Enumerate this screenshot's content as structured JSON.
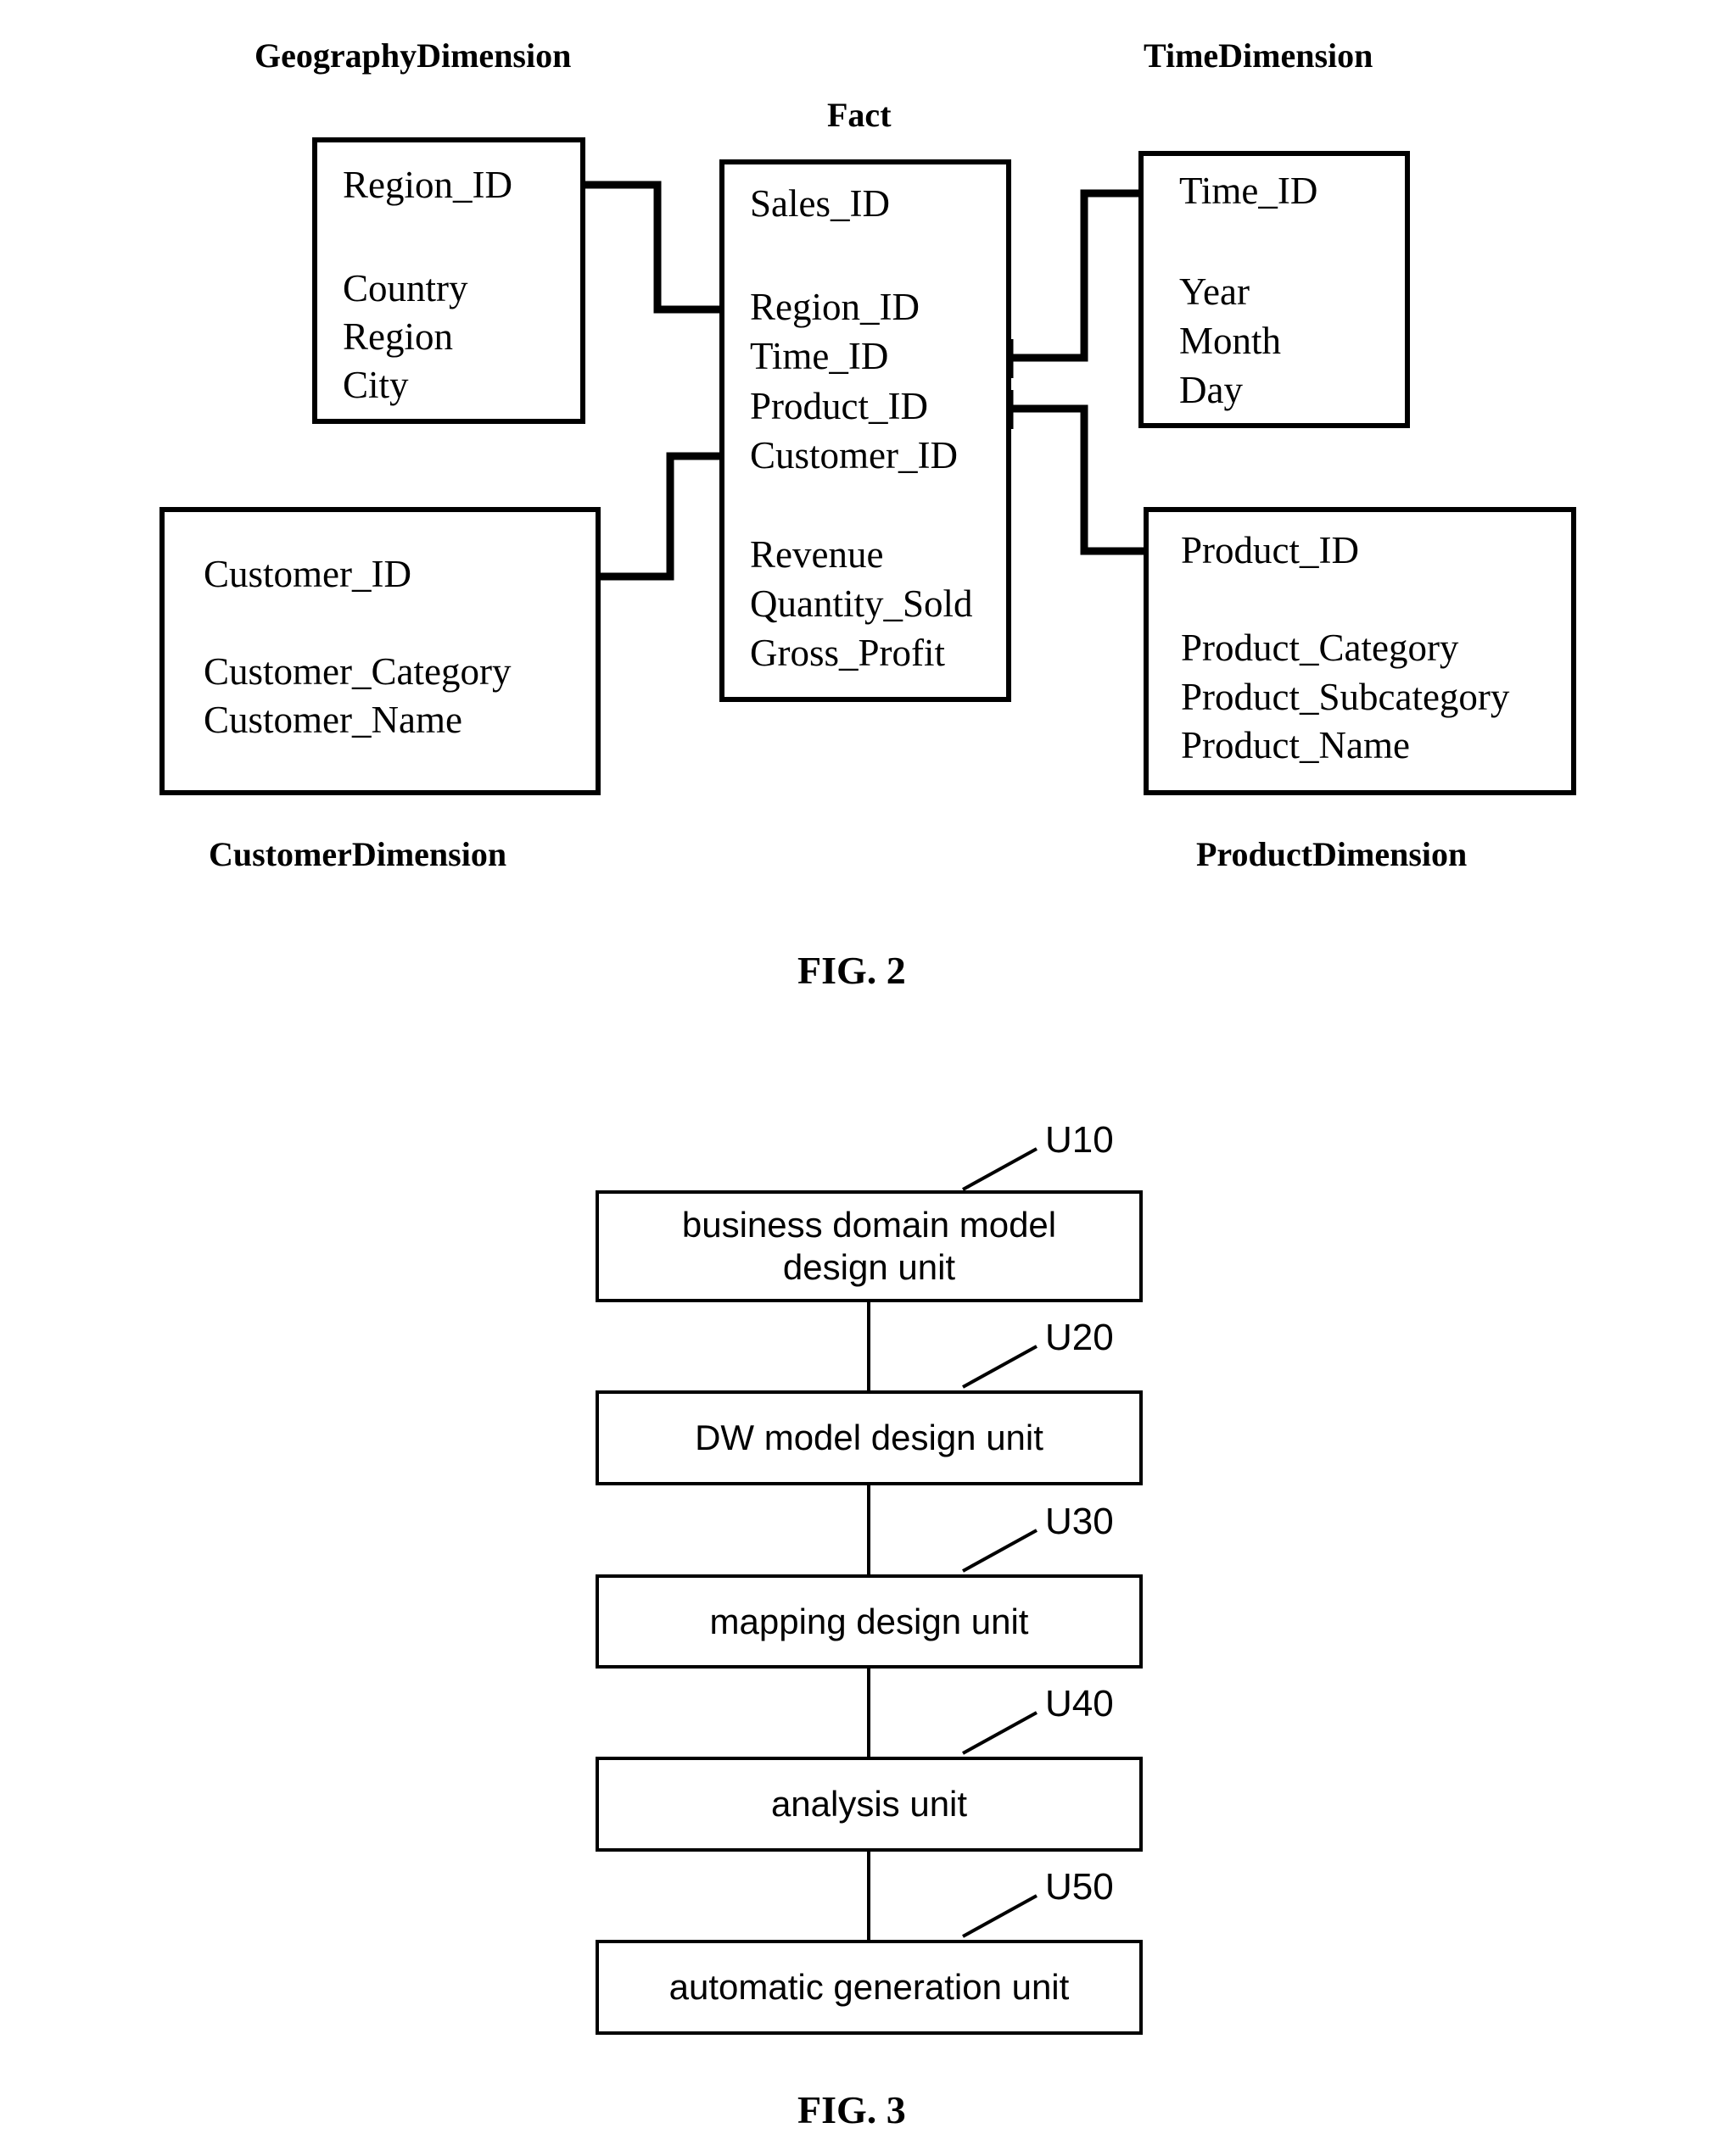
{
  "figures": [
    {
      "id": "fig2",
      "caption": "FIG. 2",
      "type": "star-schema-er-diagram",
      "entities": [
        {
          "name": "GeographyDimension",
          "title_position": "above",
          "key_attributes": [
            "Region_ID"
          ],
          "attributes": [
            "Country",
            "Region",
            "City"
          ]
        },
        {
          "name": "Fact",
          "title_position": "above",
          "key_attributes": [
            "Sales_ID"
          ],
          "foreign_keys": [
            "Region_ID",
            "Time_ID",
            "Product_ID",
            "Customer_ID"
          ],
          "measures": [
            "Revenue",
            "Quantity_Sold",
            "Gross_Profit"
          ]
        },
        {
          "name": "TimeDimension",
          "title_position": "above",
          "key_attributes": [
            "Time_ID"
          ],
          "attributes": [
            "Year",
            "Month",
            "Day"
          ]
        },
        {
          "name": "CustomerDimension",
          "title_position": "below",
          "key_attributes": [
            "Customer_ID"
          ],
          "attributes": [
            "Customer_Category",
            "Customer_Name"
          ]
        },
        {
          "name": "ProductDimension",
          "title_position": "below",
          "key_attributes": [
            "Product_ID"
          ],
          "attributes": [
            "Product_Category",
            "Product_Subcategory",
            "Product_Name"
          ]
        }
      ],
      "relationships": [
        {
          "from": "GeographyDimension.Region_ID",
          "to": "Fact.Region_ID"
        },
        {
          "from": "Fact.Time_ID",
          "to": "TimeDimension.Time_ID"
        },
        {
          "from": "Fact.Product_ID",
          "to": "ProductDimension.Product_ID"
        },
        {
          "from": "CustomerDimension.Customer_ID",
          "to": "Fact.Customer_ID"
        }
      ]
    },
    {
      "id": "fig3",
      "caption": "FIG. 3",
      "type": "vertical-flowchart",
      "steps": [
        {
          "ref": "U10",
          "label": "business domain model design unit",
          "label_lines": [
            "business domain model",
            "design unit"
          ]
        },
        {
          "ref": "U20",
          "label": "DW model design unit",
          "label_lines": [
            "DW model design unit"
          ]
        },
        {
          "ref": "U30",
          "label": "mapping design unit",
          "label_lines": [
            "mapping design unit"
          ]
        },
        {
          "ref": "U40",
          "label": "analysis unit",
          "label_lines": [
            "analysis unit"
          ]
        },
        {
          "ref": "U50",
          "label": "automatic generation unit",
          "label_lines": [
            "automatic generation unit"
          ]
        }
      ]
    }
  ],
  "fig2": {
    "captions": {
      "fig": "FIG. 2"
    },
    "geography": {
      "title": "GeographyDimension",
      "a0": "Region_ID",
      "a1": "Country",
      "a2": "Region",
      "a3": "City"
    },
    "fact": {
      "title": "Fact",
      "a0": "Sales_ID",
      "a1": "Region_ID",
      "a2": "Time_ID",
      "a3": "Product_ID",
      "a4": "Customer_ID",
      "a5": "Revenue",
      "a6": "Quantity_Sold",
      "a7": "Gross_Profit"
    },
    "time": {
      "title": "TimeDimension",
      "a0": "Time_ID",
      "a1": "Year",
      "a2": "Month",
      "a3": "Day"
    },
    "customer": {
      "title": "CustomerDimension",
      "a0": "Customer_ID",
      "a1": "Customer_Category",
      "a2": "Customer_Name"
    },
    "product": {
      "title": "ProductDimension",
      "a0": "Product_ID",
      "a1": "Product_Category",
      "a2": "Product_Subcategory",
      "a3": "Product_Name"
    }
  },
  "fig3": {
    "captions": {
      "fig": "FIG. 3"
    },
    "u10": {
      "ref": "U10",
      "line1": "business domain model",
      "line2": "design unit"
    },
    "u20": {
      "ref": "U20",
      "line1": "DW model design unit"
    },
    "u30": {
      "ref": "U30",
      "line1": "mapping design unit"
    },
    "u40": {
      "ref": "U40",
      "line1": "analysis unit"
    },
    "u50": {
      "ref": "U50",
      "line1": "automatic generation unit"
    }
  },
  "colors": {
    "ink": "#000000",
    "paper": "#ffffff"
  }
}
